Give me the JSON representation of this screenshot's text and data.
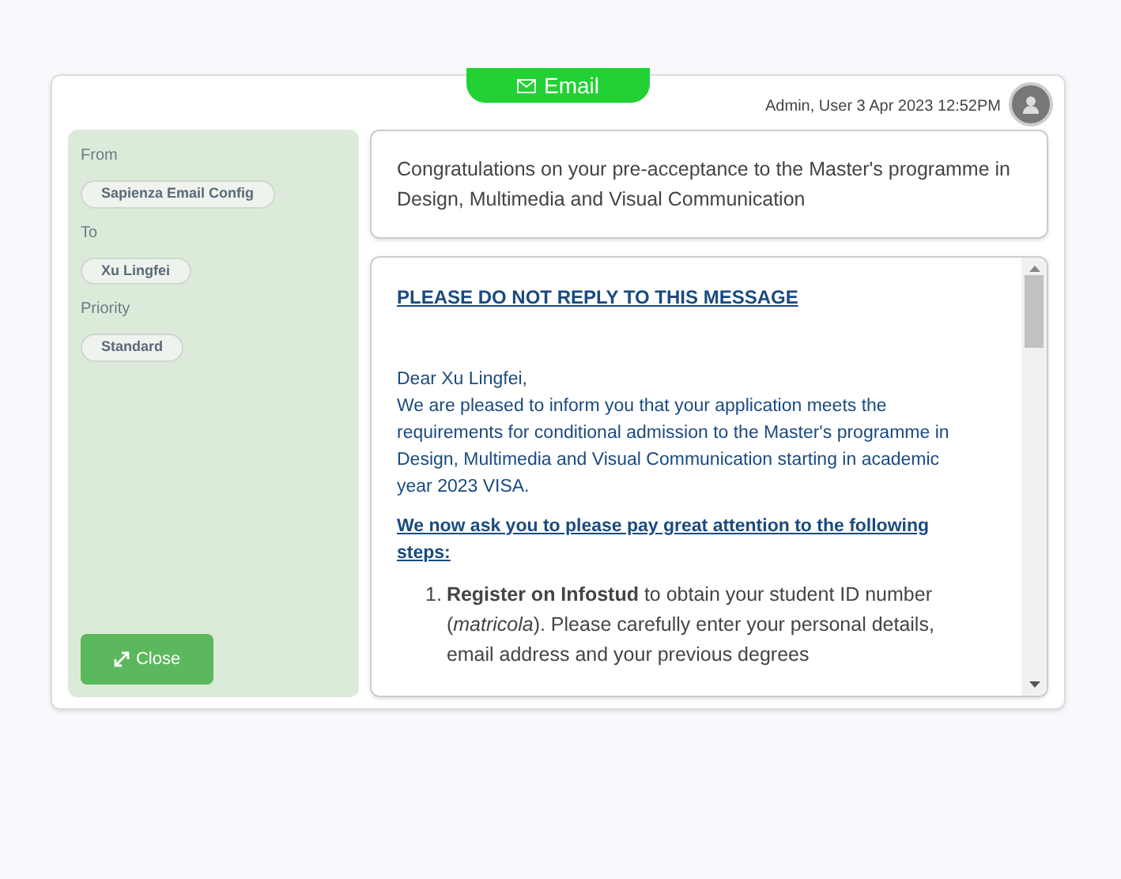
{
  "tab": {
    "label": "Email"
  },
  "meta": "Admin, User 3 Apr 2023 12:52PM",
  "fields": [
    {
      "label": "From",
      "value": "Sapienza Email Config"
    },
    {
      "label": "To",
      "value": "Xu Lingfei"
    },
    {
      "label": "Priority",
      "value": "Standard"
    }
  ],
  "close_button": "Close",
  "subject": "Congratulations on your pre-acceptance to the Master's programme in Design, Multimedia and Visual Communication",
  "body": {
    "heading": "PLEASE DO NOT REPLY TO THIS MESSAGE",
    "greeting": "Dear Xu Lingfei,",
    "paragraph": "We are pleased to inform you that your application meets the requirements for conditional admission to the Master's programme in Design, Multimedia and Visual Communication starting in academic year 2023 VISA.",
    "steps_intro": "We now ask you to please pay great attention to the following steps:",
    "steps": [
      {
        "number": "1.",
        "text": "**Register on Infostud** to obtain your student ID number (*matricola*). Please carefully enter your personal details, email address and your previous degrees"
      }
    ]
  }
}
